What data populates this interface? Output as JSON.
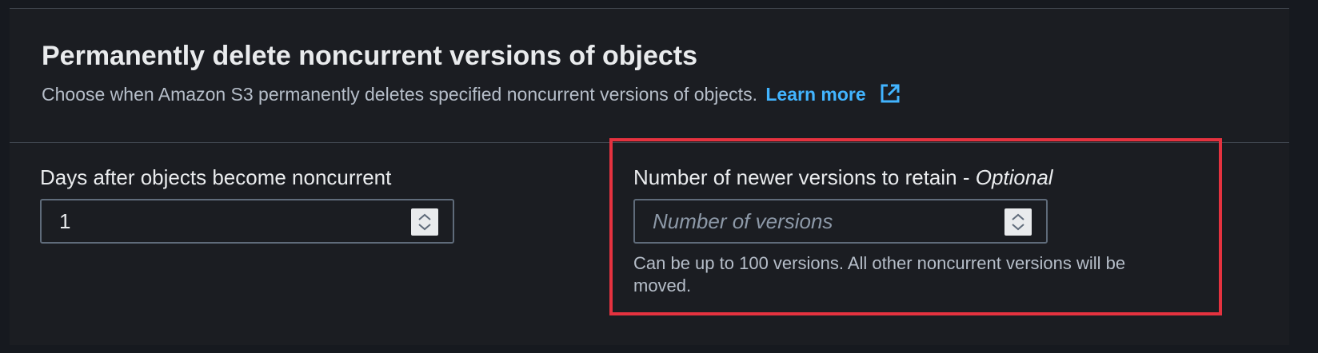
{
  "section": {
    "title": "Permanently delete noncurrent versions of objects",
    "description": "Choose when Amazon S3 permanently deletes specified noncurrent versions of objects.",
    "learn_more": "Learn more",
    "learn_more_icon": "external-link-icon"
  },
  "fields": {
    "days": {
      "label": "Days after objects become noncurrent",
      "value": "1",
      "stepper_icon": "up-down-chevron-icon"
    },
    "versions": {
      "label": "Number of newer versions to retain - ",
      "label_suffix": "Optional",
      "value": "",
      "placeholder": "Number of versions",
      "helper": "Can be up to 100 versions. All other noncurrent versions will be moved.",
      "stepper_icon": "up-down-chevron-icon"
    }
  },
  "highlight": {
    "color": "#e5323f"
  },
  "colors": {
    "background": "#1b1d22",
    "text": "#e9ebed",
    "secondary_text": "#b6bec9",
    "link": "#42b4ff",
    "border": "#5f6b7a"
  }
}
